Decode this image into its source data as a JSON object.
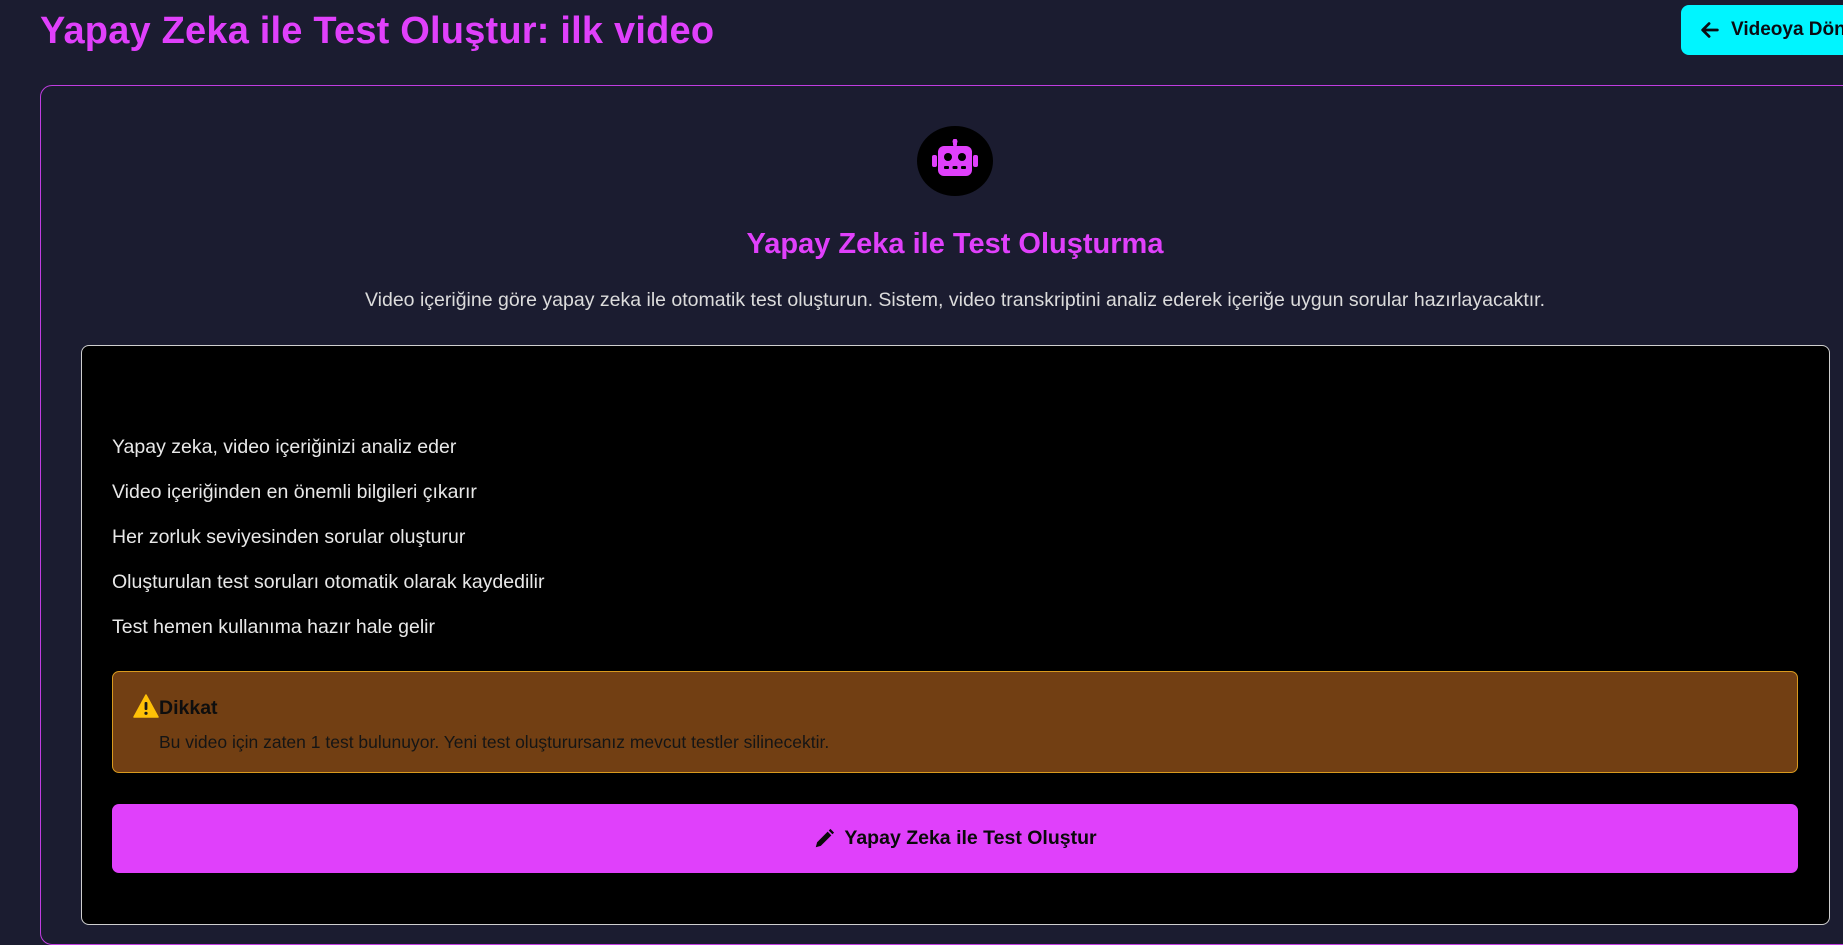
{
  "header": {
    "title": "Yapay Zeka ile Test Oluştur: ilk video",
    "back_button_label": "Videoya Dön"
  },
  "generator": {
    "icon": "robot-icon",
    "title": "Yapay Zeka ile Test Oluşturma",
    "description": "Video içeriğine göre yapay zeka ile otomatik test oluşturun. Sistem, video transkriptini analiz ederek içeriğe uygun sorular hazırlayacaktır.",
    "features": [
      "Yapay zeka, video içeriğinizi analiz eder",
      "Video içeriğinden en önemli bilgileri çıkarır",
      "Her zorluk seviyesinden sorular oluşturur",
      "Oluşturulan test soruları otomatik olarak kaydedilir",
      "Test hemen kullanıma hazır hale gelir"
    ],
    "warning": {
      "icon": "warning-icon",
      "title": "Dikkat",
      "text": "Bu video için zaten 1 test bulunuyor. Yeni test oluşturursanız mevcut testler silinecektir."
    },
    "create_button_label": "Yapay Zeka ile Test Oluştur",
    "create_button_icon": "pencil-icon"
  },
  "colors": {
    "background": "#1b1c30",
    "accent": "#e040fb",
    "back_button": "#00f5ff",
    "warning_bg": "#723f13",
    "warning_border": "#d99a1e"
  }
}
